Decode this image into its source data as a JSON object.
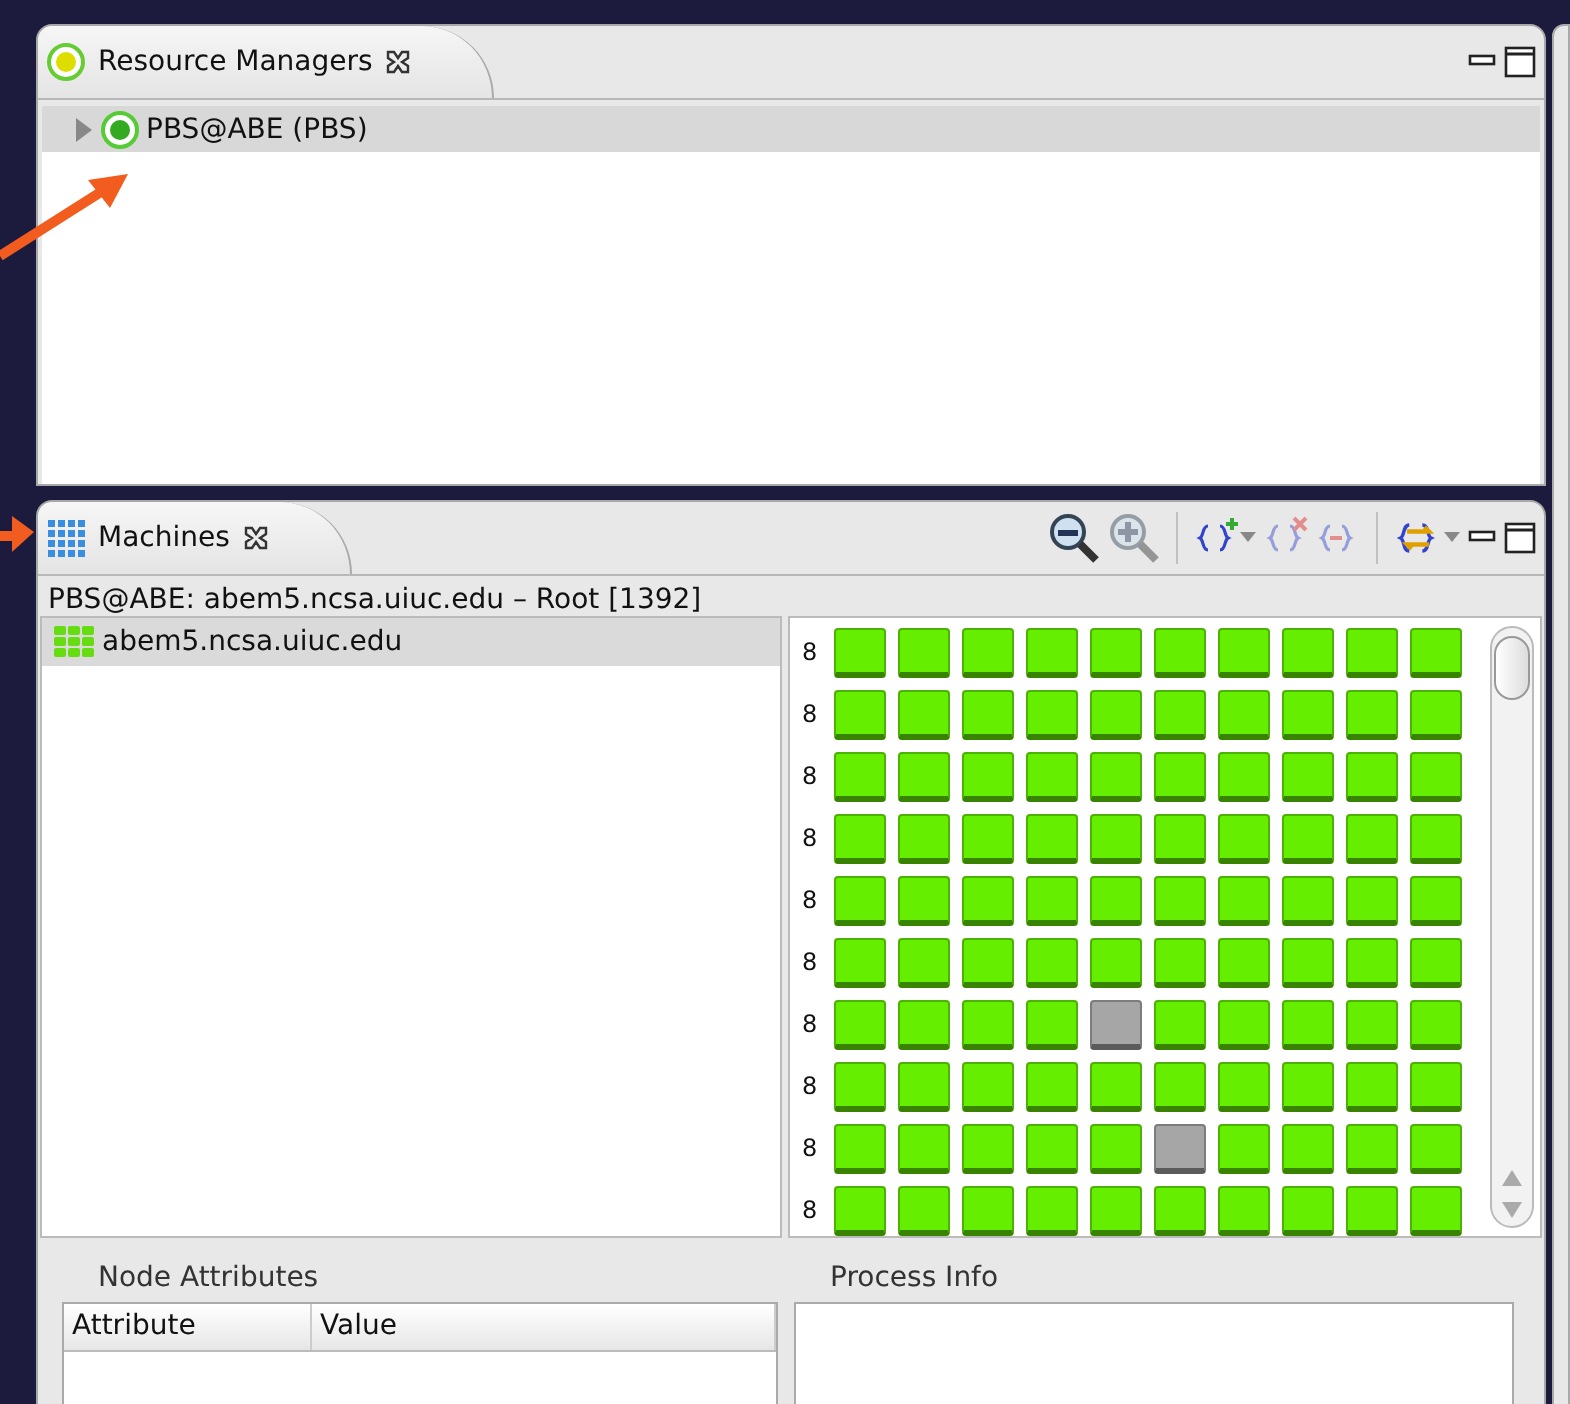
{
  "resource_managers": {
    "tab": {
      "label": "Resource Managers",
      "selected": true
    },
    "tree": [
      {
        "label": "PBS@ABE (PBS)",
        "expanded": false,
        "selected": true
      }
    ]
  },
  "machines": {
    "tab": {
      "label": "Machines",
      "selected": true
    },
    "toolbar": [
      {
        "kind": "zoom-out",
        "disabled": false,
        "dropdown": false
      },
      {
        "kind": "zoom-in",
        "disabled": true,
        "dropdown": false
      },
      {
        "kind": "add-set",
        "disabled": false,
        "dropdown": true
      },
      {
        "kind": "remove-set",
        "disabled": true,
        "dropdown": false
      },
      {
        "kind": "delete-set",
        "disabled": true,
        "dropdown": false
      },
      {
        "kind": "filter",
        "disabled": false,
        "dropdown": true
      }
    ],
    "header": "PBS@ABE: abem5.ncsa.uiuc.edu – Root [1392]",
    "machine_list": [
      {
        "label": "abem5.ncsa.uiuc.edu",
        "selected": true
      }
    ],
    "node_rows": [
      {
        "label": "8",
        "nodes": [
          {
            "color": "#66ee00"
          },
          {
            "color": "#66ee00"
          },
          {
            "color": "#66ee00"
          },
          {
            "color": "#66ee00"
          },
          {
            "color": "#66ee00"
          },
          {
            "color": "#66ee00"
          },
          {
            "color": "#66ee00"
          },
          {
            "color": "#66ee00"
          },
          {
            "color": "#66ee00"
          },
          {
            "color": "#66ee00"
          }
        ]
      },
      {
        "label": "8",
        "nodes": [
          {
            "color": "#66ee00"
          },
          {
            "color": "#66ee00"
          },
          {
            "color": "#66ee00"
          },
          {
            "color": "#66ee00"
          },
          {
            "color": "#66ee00"
          },
          {
            "color": "#66ee00"
          },
          {
            "color": "#66ee00"
          },
          {
            "color": "#66ee00"
          },
          {
            "color": "#66ee00"
          },
          {
            "color": "#66ee00"
          }
        ]
      },
      {
        "label": "8",
        "nodes": [
          {
            "color": "#66ee00"
          },
          {
            "color": "#66ee00"
          },
          {
            "color": "#66ee00"
          },
          {
            "color": "#66ee00"
          },
          {
            "color": "#66ee00"
          },
          {
            "color": "#66ee00"
          },
          {
            "color": "#66ee00"
          },
          {
            "color": "#66ee00"
          },
          {
            "color": "#66ee00"
          },
          {
            "color": "#66ee00"
          }
        ]
      },
      {
        "label": "8",
        "nodes": [
          {
            "color": "#66ee00"
          },
          {
            "color": "#66ee00"
          },
          {
            "color": "#66ee00"
          },
          {
            "color": "#66ee00"
          },
          {
            "color": "#66ee00"
          },
          {
            "color": "#66ee00"
          },
          {
            "color": "#66ee00"
          },
          {
            "color": "#66ee00"
          },
          {
            "color": "#66ee00"
          },
          {
            "color": "#66ee00"
          }
        ]
      },
      {
        "label": "8",
        "nodes": [
          {
            "color": "#66ee00"
          },
          {
            "color": "#66ee00"
          },
          {
            "color": "#66ee00"
          },
          {
            "color": "#66ee00"
          },
          {
            "color": "#66ee00"
          },
          {
            "color": "#66ee00"
          },
          {
            "color": "#66ee00"
          },
          {
            "color": "#66ee00"
          },
          {
            "color": "#66ee00"
          },
          {
            "color": "#66ee00"
          }
        ]
      },
      {
        "label": "8",
        "nodes": [
          {
            "color": "#66ee00"
          },
          {
            "color": "#66ee00"
          },
          {
            "color": "#66ee00"
          },
          {
            "color": "#66ee00"
          },
          {
            "color": "#66ee00"
          },
          {
            "color": "#66ee00"
          },
          {
            "color": "#66ee00"
          },
          {
            "color": "#66ee00"
          },
          {
            "color": "#66ee00"
          },
          {
            "color": "#66ee00"
          }
        ]
      },
      {
        "label": "8",
        "nodes": [
          {
            "color": "#66ee00"
          },
          {
            "color": "#66ee00"
          },
          {
            "color": "#66ee00"
          },
          {
            "color": "#66ee00"
          },
          {
            "color": "#a6a6a6"
          },
          {
            "color": "#66ee00"
          },
          {
            "color": "#66ee00"
          },
          {
            "color": "#66ee00"
          },
          {
            "color": "#66ee00"
          },
          {
            "color": "#66ee00"
          }
        ]
      },
      {
        "label": "8",
        "nodes": [
          {
            "color": "#66ee00"
          },
          {
            "color": "#66ee00"
          },
          {
            "color": "#66ee00"
          },
          {
            "color": "#66ee00"
          },
          {
            "color": "#66ee00"
          },
          {
            "color": "#66ee00"
          },
          {
            "color": "#66ee00"
          },
          {
            "color": "#66ee00"
          },
          {
            "color": "#66ee00"
          },
          {
            "color": "#66ee00"
          }
        ]
      },
      {
        "label": "8",
        "nodes": [
          {
            "color": "#66ee00"
          },
          {
            "color": "#66ee00"
          },
          {
            "color": "#66ee00"
          },
          {
            "color": "#66ee00"
          },
          {
            "color": "#66ee00"
          },
          {
            "color": "#a6a6a6"
          },
          {
            "color": "#66ee00"
          },
          {
            "color": "#66ee00"
          },
          {
            "color": "#66ee00"
          },
          {
            "color": "#66ee00"
          }
        ]
      },
      {
        "label": "8",
        "nodes": [
          {
            "color": "#66ee00"
          },
          {
            "color": "#66ee00"
          },
          {
            "color": "#66ee00"
          },
          {
            "color": "#66ee00"
          },
          {
            "color": "#66ee00"
          },
          {
            "color": "#66ee00"
          },
          {
            "color": "#66ee00"
          },
          {
            "color": "#66ee00"
          },
          {
            "color": "#66ee00"
          },
          {
            "color": "#66ee00"
          }
        ]
      }
    ],
    "node_attributes": {
      "title": "Node Attributes",
      "columns": [
        "Attribute",
        "Value"
      ]
    },
    "process_info": {
      "title": "Process Info"
    }
  }
}
